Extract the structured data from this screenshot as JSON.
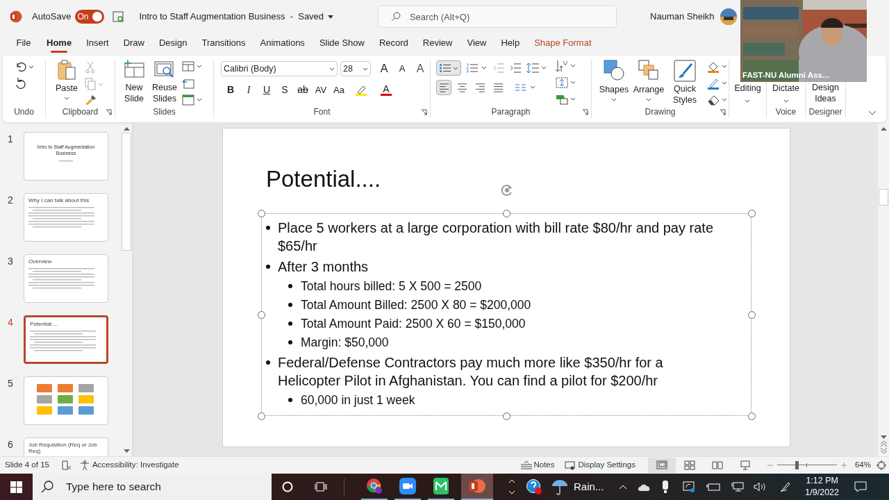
{
  "title_bar": {
    "autosave": {
      "label": "AutoSave",
      "toggle_label": "On",
      "on": true
    },
    "document_title": "Intro to Staff Augmentation Business  -  Saved",
    "search": {
      "placeholder": "Search (Alt+Q)"
    },
    "user_name": "Nauman Sheikh"
  },
  "menu_tabs": [
    {
      "label": "File",
      "selected": false,
      "kind": "plain"
    },
    {
      "label": "Home",
      "selected": true,
      "kind": "plain"
    },
    {
      "label": "Insert",
      "selected": false,
      "kind": "plain"
    },
    {
      "label": "Draw",
      "selected": false,
      "kind": "plain"
    },
    {
      "label": "Design",
      "selected": false,
      "kind": "plain"
    },
    {
      "label": "Transitions",
      "selected": false,
      "kind": "plain"
    },
    {
      "label": "Animations",
      "selected": false,
      "kind": "plain"
    },
    {
      "label": "Slide Show",
      "selected": false,
      "kind": "plain"
    },
    {
      "label": "Record",
      "selected": false,
      "kind": "plain"
    },
    {
      "label": "Review",
      "selected": false,
      "kind": "plain"
    },
    {
      "label": "View",
      "selected": false,
      "kind": "plain"
    },
    {
      "label": "Help",
      "selected": false,
      "kind": "plain"
    },
    {
      "label": "Shape Format",
      "selected": false,
      "kind": "contextual"
    }
  ],
  "ribbon": {
    "group_labels": [
      "Undo",
      "Clipboard",
      "Slides",
      "Font",
      "Paragraph",
      "Drawing",
      "Voice",
      "Designer"
    ],
    "paste": "Paste",
    "new_slide": [
      "New",
      "Slide"
    ],
    "reuse_slides": [
      "Reuse",
      "Slides"
    ],
    "font_name": "Calibri (Body)",
    "font_size": "28",
    "font_glyphs": [
      "A",
      "A",
      "A"
    ],
    "font_buttons": [
      "B",
      "I",
      "U",
      "S",
      "ab",
      "AV",
      "Aa"
    ],
    "font_color_glyph": "A",
    "bullets_on": true,
    "paragraph_align": [
      {
        "selected": true
      },
      {
        "selected": false
      },
      {
        "selected": false
      },
      {
        "selected": false
      }
    ],
    "shapes": "Shapes",
    "arrange": "Arrange",
    "quick_styles": [
      "Quick",
      "Styles"
    ],
    "editing": "Editing",
    "dictate": "Dictate",
    "design_ideas": [
      "Design",
      "Ideas"
    ]
  },
  "webcam": {
    "caption": "FAST-NU Alumni Ass..."
  },
  "slides": [
    {
      "number": "1",
      "title": "Intro to Staff Augmentation Business",
      "kind": "title",
      "selected": false
    },
    {
      "number": "2",
      "title": "Why I can talk about this",
      "kind": "text",
      "selected": false
    },
    {
      "number": "3",
      "title": "Overview",
      "kind": "text",
      "selected": false
    },
    {
      "number": "4",
      "title": "Potential....",
      "kind": "text",
      "selected": true
    },
    {
      "number": "5",
      "kind": "diagram",
      "selected": false
    },
    {
      "number": "6",
      "title": "Job Requisition (Req or Job Req)",
      "kind": "text",
      "selected": false
    }
  ],
  "slide": {
    "title": "Potential....",
    "bullets": [
      {
        "text": "Place 5 workers at a large corporation with bill rate $80/hr and pay rate $65/hr"
      },
      {
        "text": "After 3 months",
        "children": [
          {
            "text": "Total hours billed: 5 X 500 = 2500"
          },
          {
            "text": "Total Amount Billed: 2500 X 80 = $200,000"
          },
          {
            "text": "Total Amount Paid: 2500 X 60 = $150,000"
          },
          {
            "text": "Margin: $50,000"
          }
        ]
      },
      {
        "text": "Federal/Defense Contractors pay much more like $350/hr for a Helicopter Pilot in Afghanistan. You can find a pilot for $200/hr",
        "children": [
          {
            "text": "60,000 in just 1 week"
          }
        ]
      }
    ]
  },
  "status_bar": {
    "slide_counter": "Slide 4 of 15",
    "accessibility": "Accessibility: Investigate",
    "notes": "Notes",
    "display_settings": "Display Settings",
    "views": [
      {
        "selected": true
      },
      {
        "selected": false
      },
      {
        "selected": false
      },
      {
        "selected": false
      }
    ],
    "zoom_slider": {
      "level": 0.32
    },
    "zoom": "64%"
  },
  "taskbar": {
    "search_placeholder": "Type here to search",
    "weather": "Rain...",
    "time": "1:12 PM",
    "date": "1/9/2022"
  }
}
